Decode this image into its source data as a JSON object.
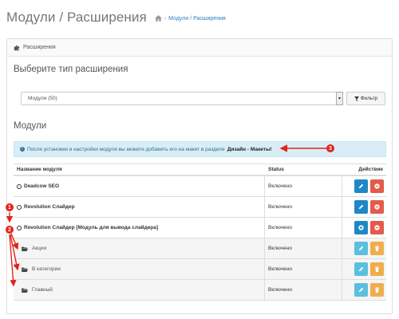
{
  "header": {
    "title": "Модули / Расширения",
    "breadcrumb_link": "Модули / Расширения",
    "breadcrumb_sep": "›"
  },
  "panel": {
    "heading": "Расширения"
  },
  "section_choose": {
    "title": "Выберите тип расширения",
    "select_value": "Модули (50)",
    "filter_label": "Фильтр"
  },
  "section_modules": {
    "title": "Модули",
    "alert_text": "После установки и настройки модуля вы можете добавить его на макет в разделе",
    "alert_bold": "Дизайн - Макеты!"
  },
  "table": {
    "headers": [
      "Название модуля",
      "Status",
      "Действие"
    ],
    "rows": [
      {
        "name": "Deadcow SEO",
        "status": "Включено",
        "type": "module",
        "buttons": "blue-red"
      },
      {
        "name": "Revolution Слайдер",
        "status": "Включено",
        "type": "module",
        "buttons": "blue-red"
      },
      {
        "name": "Revolution Слайдер [Модуль для вывода слайдера]",
        "status": "Включено",
        "type": "module",
        "buttons": "blue-red"
      },
      {
        "name": "Акции",
        "status": "Включено",
        "type": "child",
        "buttons": "lightblue-orange"
      },
      {
        "name": "В категории",
        "status": "Включено",
        "type": "child",
        "buttons": "lightblue-orange"
      },
      {
        "name": "Главный",
        "status": "Включено",
        "type": "child",
        "buttons": "lightblue-orange"
      }
    ]
  },
  "annotations": {
    "badge1": "1",
    "badge2": "2",
    "badge3": "3",
    "color": "#e2231a"
  },
  "colors": {
    "link": "#2f7fc1",
    "alert_bg": "#d9edf7",
    "btn_blue": "#1e88c7",
    "btn_red": "#e35b4a",
    "btn_lightblue": "#5bc0de",
    "btn_orange": "#f0ad4e"
  }
}
